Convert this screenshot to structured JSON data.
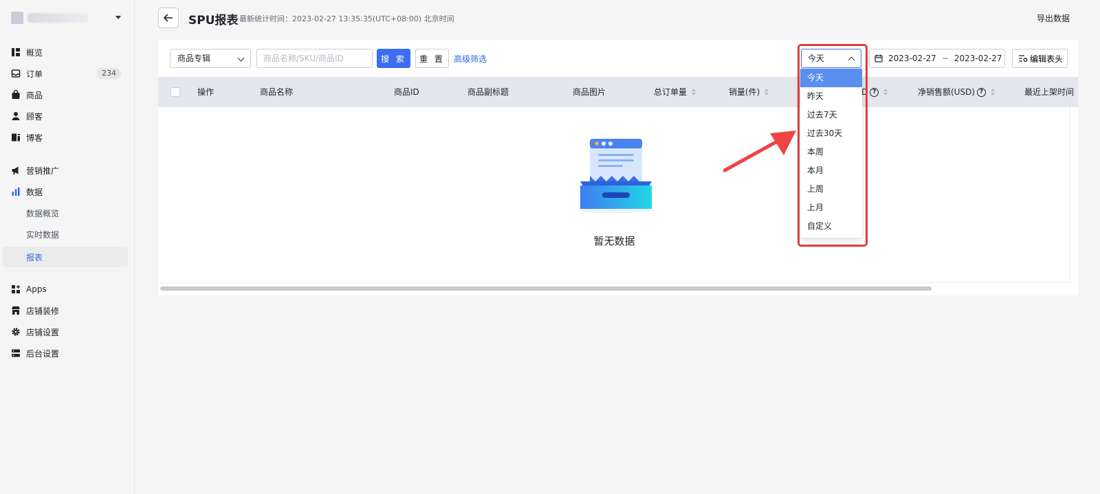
{
  "sidebar": {
    "items": [
      {
        "label": "概览",
        "icon": "dashboard-icon"
      },
      {
        "label": "订单",
        "icon": "inbox-icon",
        "badge": "234"
      },
      {
        "label": "商品",
        "icon": "bag-icon"
      },
      {
        "label": "顾客",
        "icon": "user-icon"
      },
      {
        "label": "博客",
        "icon": "blog-icon"
      },
      {
        "label": "营销推广",
        "icon": "megaphone-icon"
      },
      {
        "label": "数据",
        "icon": "bar-chart-icon"
      },
      {
        "label": "数据概览"
      },
      {
        "label": "实时数据"
      },
      {
        "label": "报表",
        "active": true
      },
      {
        "label": "Apps",
        "icon": "apps-icon"
      },
      {
        "label": "店铺装修",
        "icon": "storefront-icon"
      },
      {
        "label": "店铺设置",
        "icon": "gear-icon"
      },
      {
        "label": "后台设置",
        "icon": "server-icon"
      }
    ]
  },
  "header": {
    "title": "SPU报表",
    "meta": "最新统计时间：2023-02-27 13:35:35(UTC+08:00) 北京时间",
    "export": "导出数据"
  },
  "filters": {
    "collection": "商品专辑",
    "search_placeholder": "商品名称/SKU/商品ID",
    "search_btn": "搜 索",
    "reset_btn": "重 置",
    "advanced": "高级筛选",
    "period": "今天",
    "date_start": "2023-02-27",
    "date_sep": "~",
    "date_end": "2023-02-27",
    "edit_header": "编辑表头"
  },
  "table": {
    "columns": [
      "操作",
      "商品名称",
      "商品ID",
      "商品副标题",
      "商品图片",
      "总订单量",
      "销量(件)",
      "D",
      "净销售额(USD)",
      "最近上架时间"
    ],
    "empty": "暂无数据"
  },
  "dropdown": {
    "options": [
      "今天",
      "昨天",
      "过去7天",
      "过去30天",
      "本周",
      "本月",
      "上周",
      "上月",
      "自定义"
    ],
    "selected": "今天"
  },
  "colors": {
    "primary": "#3d6ef2",
    "link": "#2f6ae6",
    "selected_option": "#5b8fef",
    "annotation": "#e23b3b"
  }
}
